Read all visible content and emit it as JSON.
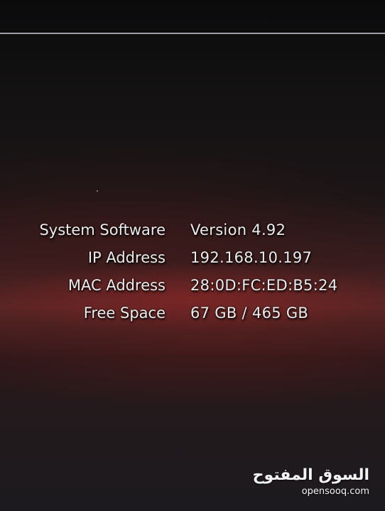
{
  "system_info": {
    "rows": [
      {
        "label": "System Software",
        "value": "Version 4.92"
      },
      {
        "label": "IP Address",
        "value": "192.168.10.197"
      },
      {
        "label": "MAC Address",
        "value": "28:0D:FC:ED:B5:24"
      },
      {
        "label": "Free Space",
        "value": "67 GB / 465 GB"
      }
    ]
  },
  "watermark": {
    "arabic": "السوق المفتوح",
    "latin": "opensooq.com"
  }
}
